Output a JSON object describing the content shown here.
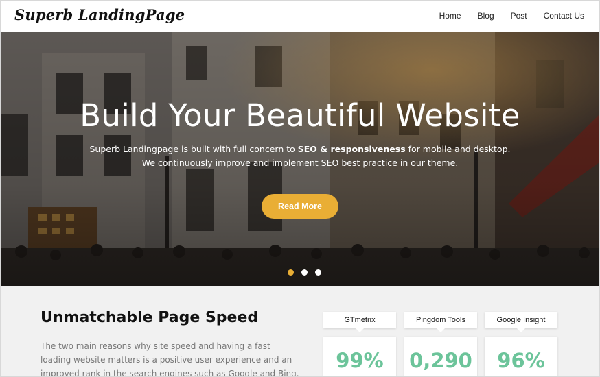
{
  "header": {
    "logo": "Superb LandingPage",
    "nav": [
      "Home",
      "Blog",
      "Post",
      "Contact Us"
    ]
  },
  "hero": {
    "title": "Build Your Beautiful Website",
    "subtitle_line1_prefix": "Superb Landingpage is built with full concern to ",
    "subtitle_line1_bold": "SEO & responsiveness",
    "subtitle_line1_suffix": " for mobile and desktop.",
    "subtitle_line2": "We continuously improve and implement SEO best practice in our theme.",
    "button": "Read More",
    "slides": 3,
    "active_slide": 0,
    "accent_color": "#e9ae35"
  },
  "speed": {
    "title": "Unmatchable Page Speed",
    "text": "The two main reasons why site speed and having a fast loading website matters is a positive user experience and an improved rank in the search engines such as Google and Bing. Studies have shown that",
    "stats": [
      {
        "label": "GTmetrix",
        "value": "99%"
      },
      {
        "label": "Pingdom Tools",
        "value": "0,290"
      },
      {
        "label": "Google Insight",
        "value": "96%"
      }
    ],
    "value_color": "#6cc49a"
  }
}
